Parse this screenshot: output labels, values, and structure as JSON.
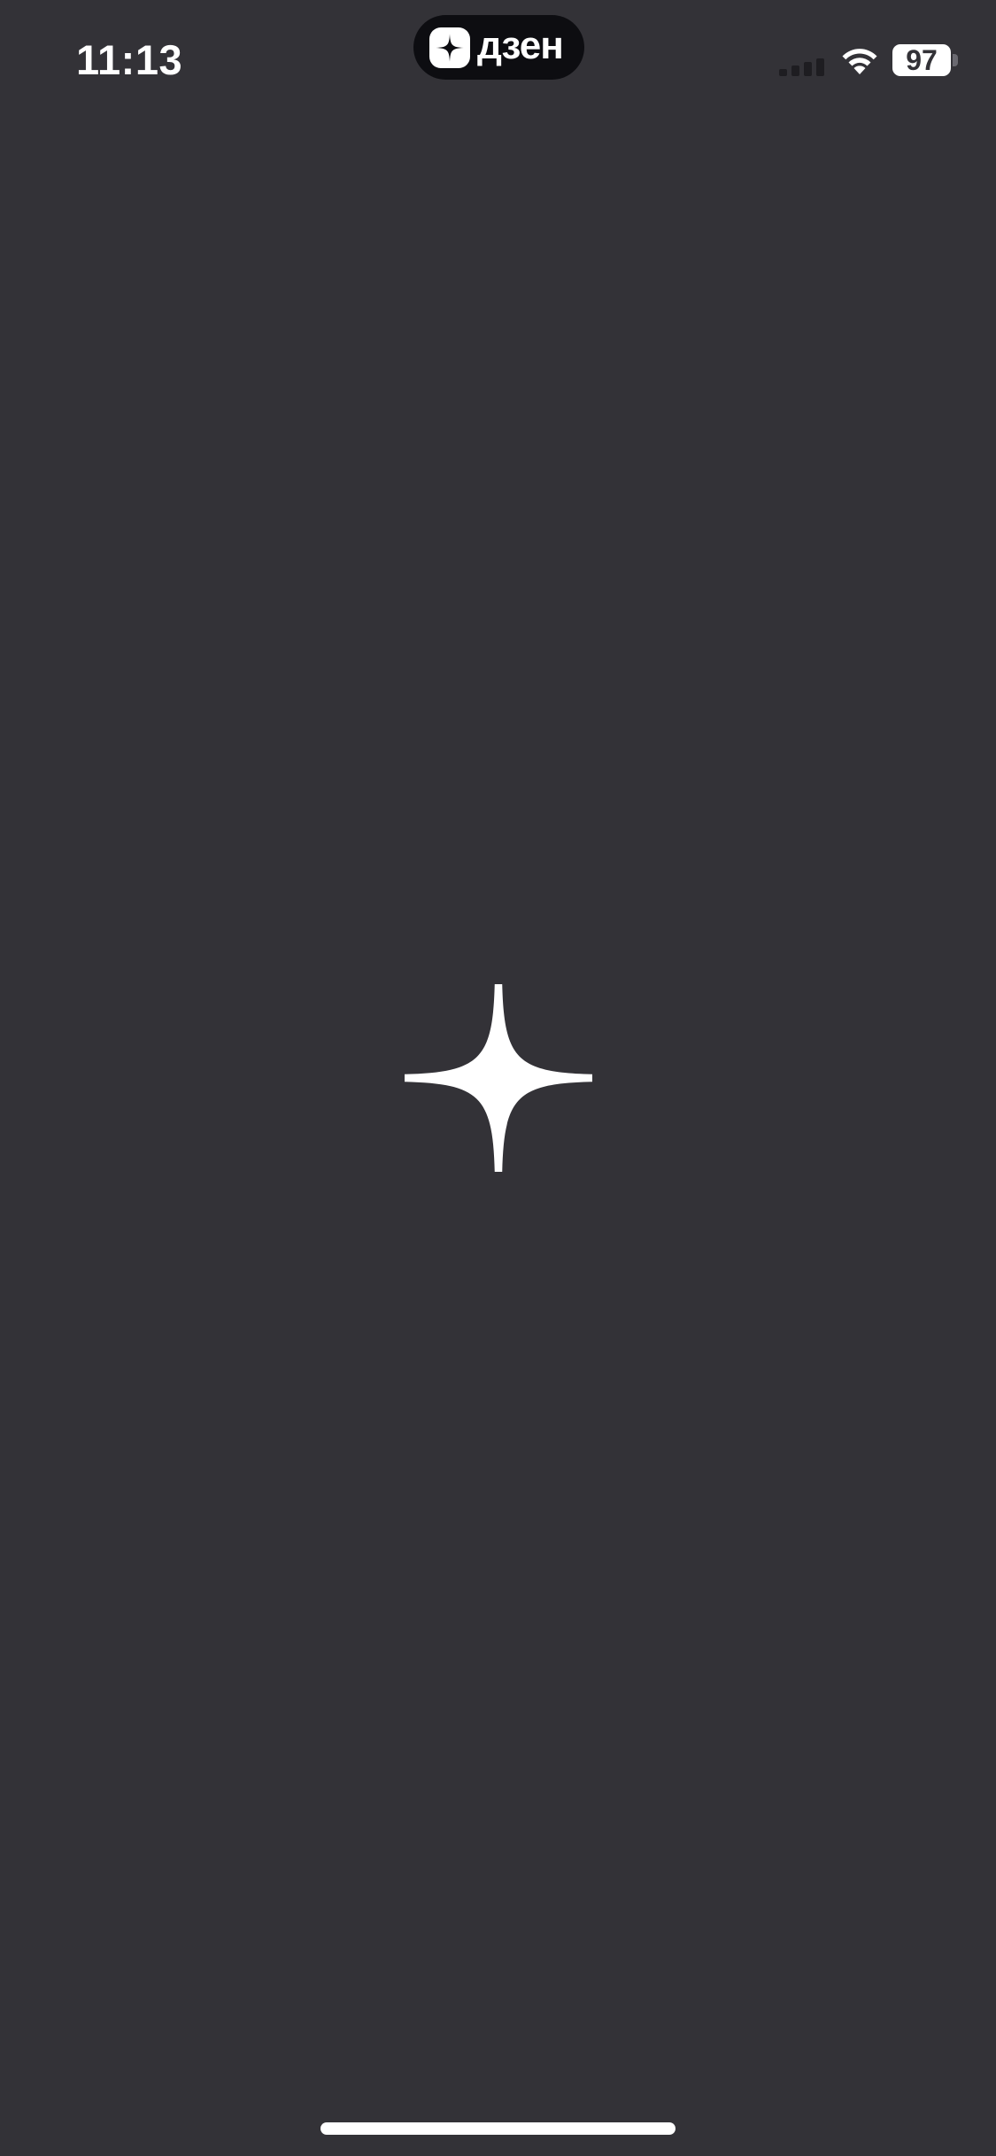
{
  "status_bar": {
    "time": "11:13",
    "battery_level": "97",
    "icons": [
      "signal-icon",
      "wifi-icon",
      "battery-icon"
    ]
  },
  "island": {
    "app_name": "дзен",
    "logo_icon": "zen-star-icon"
  },
  "splash": {
    "icon": "zen-star-icon"
  },
  "colors": {
    "background": "#333237",
    "foreground": "#ffffff",
    "pill": "#0d0d11"
  }
}
